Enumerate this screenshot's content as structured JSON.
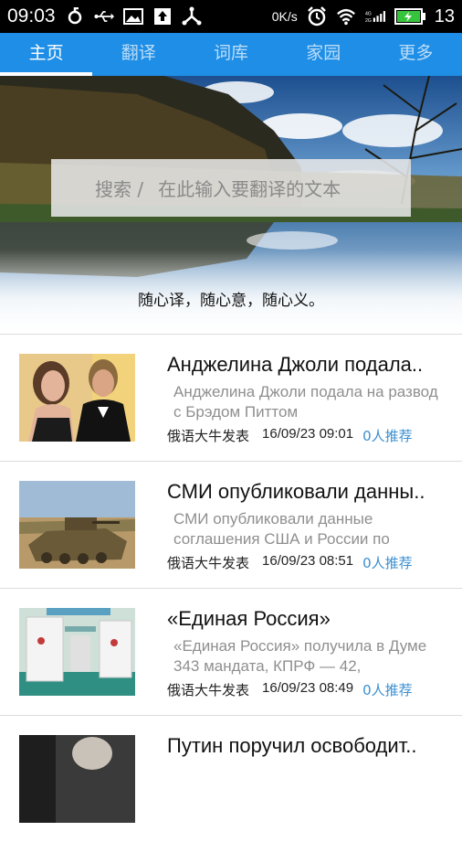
{
  "status_bar": {
    "time": "09:03",
    "net_speed": "0K/s",
    "battery": "13",
    "icons": [
      "sync-icon",
      "usb-icon",
      "image-icon",
      "upload-icon",
      "share-icon",
      "alarm-icon",
      "wifi-icon",
      "signal-icon",
      "battery-icon"
    ]
  },
  "tabs": [
    {
      "label": "主页",
      "active": true
    },
    {
      "label": "翻译",
      "active": false
    },
    {
      "label": "词库",
      "active": false
    },
    {
      "label": "家园",
      "active": false
    },
    {
      "label": "更多",
      "active": false
    }
  ],
  "banner": {
    "search_prefix": "搜索 /",
    "search_placeholder": "在此输入要翻译的文本",
    "slogan": "随心译，随心意，随心义。"
  },
  "news": [
    {
      "title": "Анджелина Джоли подала..",
      "summary": "Анджелина Джоли подала на развод с Брэдом Питтом",
      "author": "俄语大牛发表",
      "time": "16/09/23 09:01",
      "likes": "0人推荐"
    },
    {
      "title": "СМИ опубликовали данны..",
      "summary": "СМИ опубликовали данные соглашения США и России по",
      "author": "俄语大牛发表",
      "time": "16/09/23 08:51",
      "likes": "0人推荐"
    },
    {
      "title": "«Единая Россия»",
      "summary": "«Единая Россия» получила в Думе 343 мандата, КПРФ — 42,",
      "author": "俄语大牛发表",
      "time": "16/09/23 08:49",
      "likes": "0人推荐"
    },
    {
      "title": "Путин поручил освободит..",
      "summary": "",
      "author": "",
      "time": "",
      "likes": ""
    }
  ]
}
